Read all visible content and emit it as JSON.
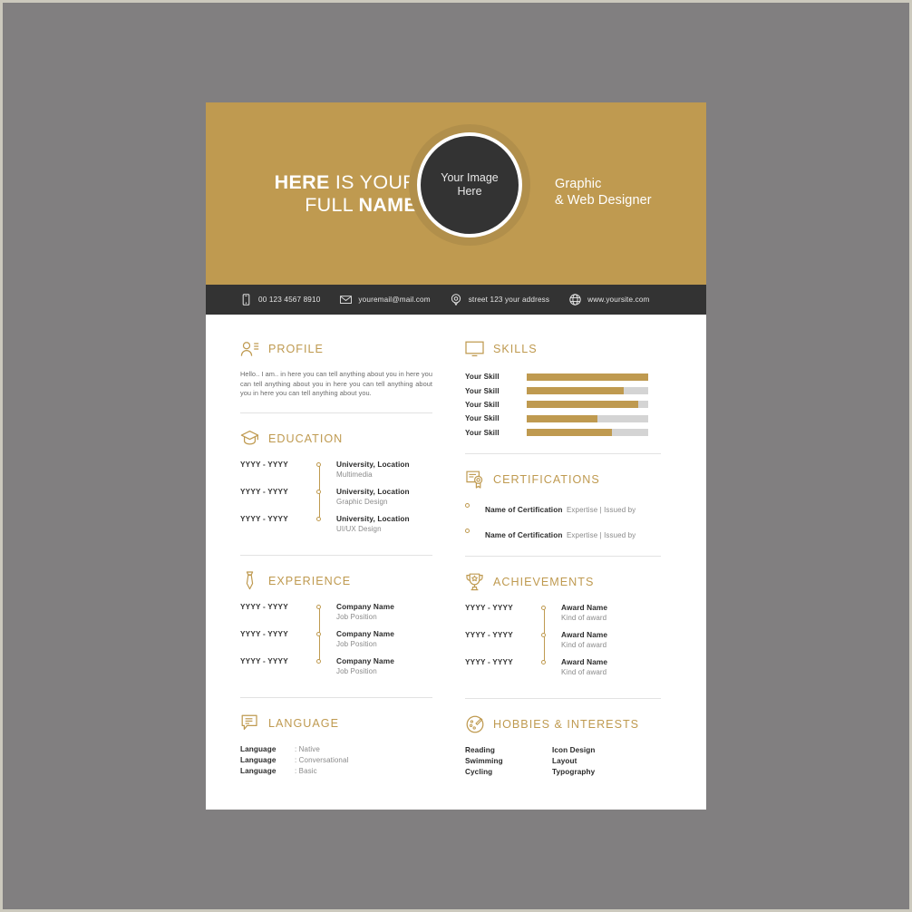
{
  "header": {
    "name_prefix": "HERE",
    "name_mid": " IS YOUR",
    "name_line2_pre": "FULL ",
    "name_line2_bold": "NAME",
    "role_line1": "Graphic",
    "role_line2": "& Web Designer",
    "avatar_line1": "Your Image",
    "avatar_line2": "Here"
  },
  "contact": [
    {
      "icon": "phone-icon",
      "text": "00 123 4567 8910"
    },
    {
      "icon": "email-icon",
      "text": "youremail@mail.com"
    },
    {
      "icon": "location-pin-icon",
      "text": "street 123 your address"
    },
    {
      "icon": "globe-icon",
      "text": "www.yoursite.com"
    }
  ],
  "profile": {
    "title": "PROFILE",
    "icon": "person-lines-icon",
    "text": "Hello.. I am.. in here you can tell anything about you in here you can tell anything about you in here you can tell anything about you in here you can tell anything about you."
  },
  "education": {
    "title": "EDUCATION",
    "icon": "graduation-cap-icon",
    "items": [
      {
        "date": "YYYY - YYYY",
        "title": "University, Location",
        "sub": "Multimedia"
      },
      {
        "date": "YYYY - YYYY",
        "title": "University, Location",
        "sub": "Graphic Design"
      },
      {
        "date": "YYYY - YYYY",
        "title": "University, Location",
        "sub": "UI/UX Design"
      }
    ]
  },
  "experience": {
    "title": "EXPERIENCE",
    "icon": "necktie-icon",
    "items": [
      {
        "date": "YYYY - YYYY",
        "title": "Company Name",
        "sub": "Job Position"
      },
      {
        "date": "YYYY - YYYY",
        "title": "Company Name",
        "sub": "Job Position"
      },
      {
        "date": "YYYY - YYYY",
        "title": "Company Name",
        "sub": "Job Position"
      }
    ]
  },
  "language": {
    "title": "LANGUAGE",
    "icon": "speech-bubble-lines-icon",
    "items": [
      {
        "name": "Language",
        "level": ": Native"
      },
      {
        "name": "Language",
        "level": ": Conversational"
      },
      {
        "name": "Language",
        "level": ": Basic"
      }
    ]
  },
  "skills": {
    "title": "SKILLS",
    "icon": "monitor-icon",
    "items": [
      {
        "name": "Your Skill",
        "percent": 100
      },
      {
        "name": "Your Skill",
        "percent": 80
      },
      {
        "name": "Your Skill",
        "percent": 92
      },
      {
        "name": "Your Skill",
        "percent": 58
      },
      {
        "name": "Your Skill",
        "percent": 70
      }
    ]
  },
  "certifications": {
    "title": "CERTIFICATIONS",
    "icon": "certificate-icon",
    "items": [
      {
        "title": "Name of Certification",
        "sub": "Expertise | Issued by"
      },
      {
        "title": "Name of Certification",
        "sub": "Expertise | Issued by"
      }
    ]
  },
  "achievements": {
    "title": "ACHIEVEMENTS",
    "icon": "trophy-icon",
    "items": [
      {
        "date": "YYYY - YYYY",
        "title": "Award Name",
        "sub": "Kind of award"
      },
      {
        "date": "YYYY - YYYY",
        "title": "Award Name",
        "sub": "Kind of award"
      },
      {
        "date": "YYYY - YYYY",
        "title": "Award Name",
        "sub": "Kind of award"
      }
    ]
  },
  "hobbies": {
    "title": "HOBBIES & INTERESTS",
    "icon": "palette-icon",
    "column1": [
      "Reading",
      "Swimming",
      "Cycling"
    ],
    "column2": [
      "Icon Design",
      "Layout",
      "Typography"
    ]
  },
  "colors": {
    "gold": "#bf9a50",
    "gold_dark": "#b18f4b",
    "dark": "#333333",
    "page_background": "#817f80",
    "sheet": "#ffffff",
    "track": "#d4d4d4"
  }
}
